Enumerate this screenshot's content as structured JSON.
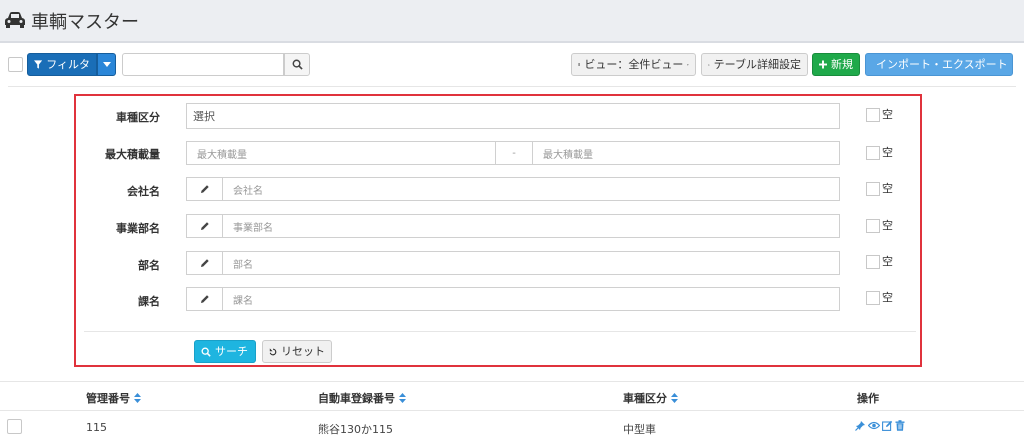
{
  "header": {
    "title": "車輌マスター",
    "icon": "car-icon"
  },
  "toolbar": {
    "filter_label": "フィルタ",
    "search_placeholder": "",
    "view_label": "ビュー：全件ビュー",
    "table_settings_label": "テーブル詳細設定",
    "new_label": "新規",
    "import_export_label": "インポート・エクスポート"
  },
  "filter_panel": {
    "rows": [
      {
        "label": "車種区分",
        "placeholder": "選択",
        "empty_label": "空"
      },
      {
        "label": "最大積載量",
        "from_placeholder": "最大積載量",
        "separator": "-",
        "to_placeholder": "最大積載量",
        "empty_label": "空"
      },
      {
        "label": "会社名",
        "placeholder": "会社名",
        "empty_label": "空"
      },
      {
        "label": "事業部名",
        "placeholder": "事業部名",
        "empty_label": "空"
      },
      {
        "label": "部名",
        "placeholder": "部名",
        "empty_label": "空"
      },
      {
        "label": "課名",
        "placeholder": "課名",
        "empty_label": "空"
      }
    ],
    "search_label": "サーチ",
    "reset_label": "リセット"
  },
  "table": {
    "columns": [
      "管理番号",
      "自動車登録番号",
      "車種区分",
      "操作"
    ],
    "rows": [
      {
        "id": "115",
        "registration": "熊谷130か115",
        "vehicle_type": "中型車"
      }
    ]
  },
  "colors": {
    "filter_button": "#1a6eb7",
    "new_button": "#1fa94a",
    "import_export_button": "#5aa7e6",
    "search_button": "#1eb5e0",
    "panel_outline": "#e0323c"
  }
}
